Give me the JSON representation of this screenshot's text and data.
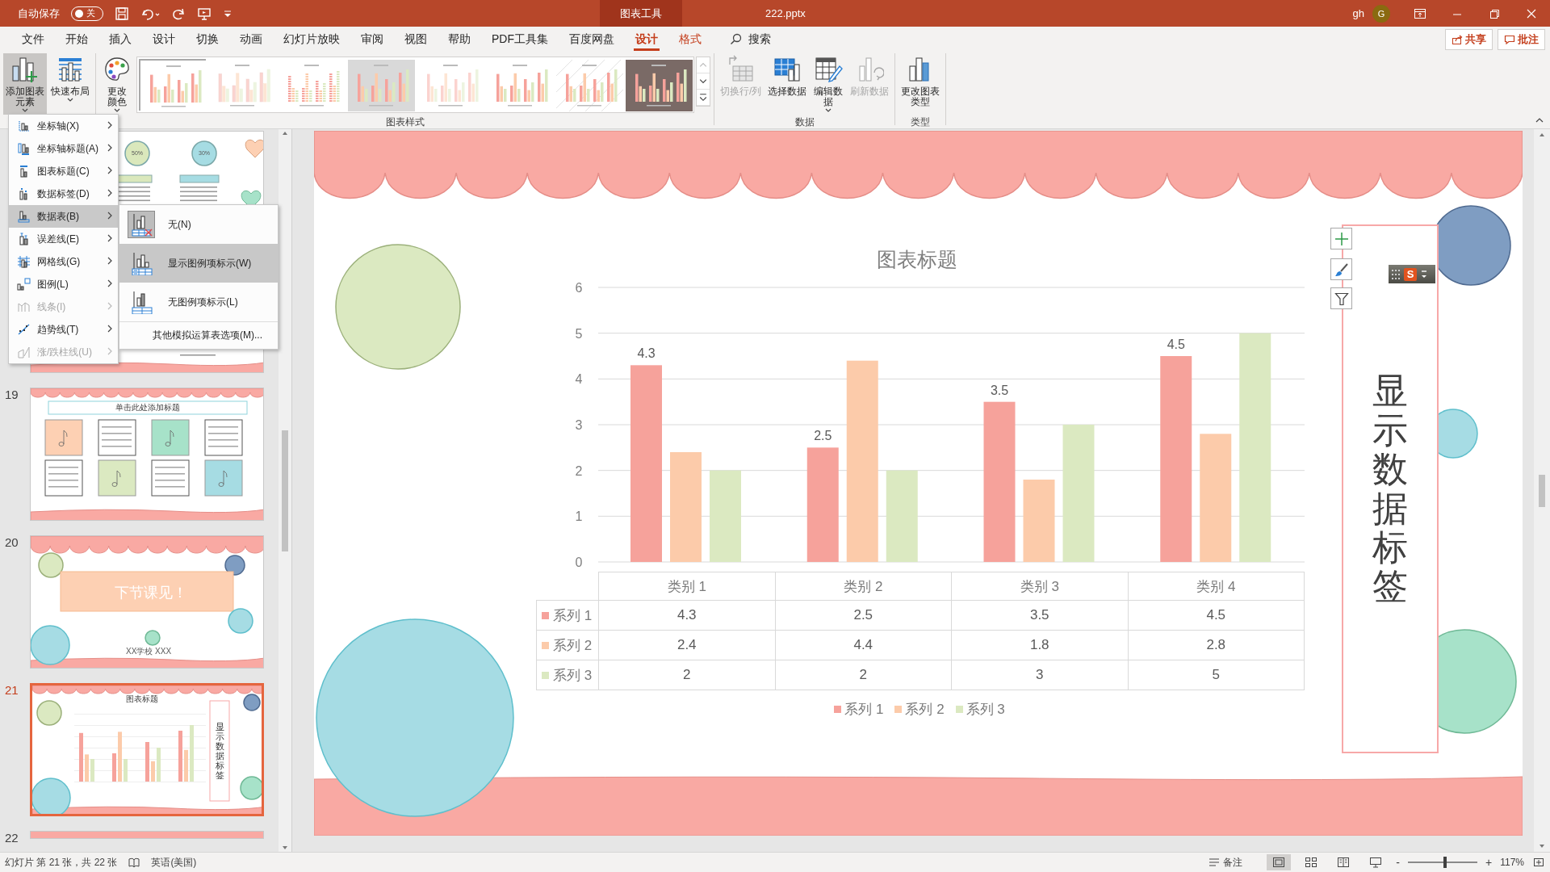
{
  "title_bar": {
    "autosave_label": "自动保存",
    "autosave_toggle": {
      "label": "关",
      "on": false
    },
    "context_tab_group": "图表工具",
    "file_name": "222.pptx",
    "user_name": "gh",
    "avatar_initial": "G"
  },
  "ribbon_tabs": [
    {
      "label": "文件",
      "kind": "normal",
      "selected": false
    },
    {
      "label": "开始",
      "kind": "normal",
      "selected": false
    },
    {
      "label": "插入",
      "kind": "normal",
      "selected": false
    },
    {
      "label": "设计",
      "kind": "normal",
      "selected": false
    },
    {
      "label": "切换",
      "kind": "normal",
      "selected": false
    },
    {
      "label": "动画",
      "kind": "normal",
      "selected": false
    },
    {
      "label": "幻灯片放映",
      "kind": "normal",
      "selected": false
    },
    {
      "label": "审阅",
      "kind": "normal",
      "selected": false
    },
    {
      "label": "视图",
      "kind": "normal",
      "selected": false
    },
    {
      "label": "帮助",
      "kind": "normal",
      "selected": false
    },
    {
      "label": "PDF工具集",
      "kind": "normal",
      "selected": false
    },
    {
      "label": "百度网盘",
      "kind": "normal",
      "selected": false
    },
    {
      "label": "设计",
      "kind": "context",
      "selected": true
    },
    {
      "label": "格式",
      "kind": "context",
      "selected": false
    }
  ],
  "search": {
    "label": "搜索"
  },
  "header_buttons": [
    {
      "label": "共享",
      "kind": "share"
    },
    {
      "label": "批注",
      "kind": "comment"
    }
  ],
  "ribbon": {
    "groups": [
      {
        "buttons": [
          {
            "label": "添加图表元素",
            "kind": "add-element",
            "dropdown": true,
            "expanded": true,
            "disabled": false
          },
          {
            "label": "快速布局",
            "kind": "quick-layout",
            "dropdown": true,
            "expanded": false,
            "disabled": false
          }
        ]
      },
      {
        "label": "图表样式",
        "buttons": [
          {
            "label": "更改颜色",
            "kind": "change-colors",
            "dropdown": true,
            "expanded": false,
            "disabled": false
          }
        ],
        "gallery": [
          {
            "kind": "plain",
            "selected": true
          },
          {
            "kind": "outline",
            "selected": false
          },
          {
            "kind": "dashed",
            "selected": false
          },
          {
            "kind": "grey",
            "selected": false
          },
          {
            "kind": "faded",
            "selected": false
          },
          {
            "kind": "plain",
            "selected": false
          },
          {
            "kind": "hatched",
            "selected": false
          },
          {
            "kind": "dark",
            "selected": false
          }
        ]
      },
      {
        "label": "数据",
        "buttons": [
          {
            "label": "切换行/列",
            "kind": "switch-row-column",
            "dropdown": false,
            "expanded": false,
            "disabled": true
          },
          {
            "label": "选择数据",
            "kind": "select-data",
            "dropdown": false,
            "expanded": false,
            "disabled": false
          },
          {
            "label": "编辑数据",
            "kind": "edit-data",
            "dropdown": true,
            "expanded": false,
            "disabled": false
          },
          {
            "label": "刷新数据",
            "kind": "refresh-data",
            "dropdown": false,
            "expanded": false,
            "disabled": true
          }
        ]
      },
      {
        "label": "类型",
        "buttons": [
          {
            "label": "更改图表类型",
            "kind": "change-chart-type",
            "dropdown": false,
            "expanded": false,
            "disabled": false
          }
        ]
      }
    ]
  },
  "chart_menu": {
    "items": [
      {
        "label": "坐标轴(X)",
        "kind": "axes",
        "disabled": false,
        "selected": false
      },
      {
        "label": "坐标轴标题(A)",
        "kind": "axis-titles",
        "disabled": false,
        "selected": false
      },
      {
        "label": "图表标题(C)",
        "kind": "chart-title",
        "disabled": false,
        "selected": false
      },
      {
        "label": "数据标签(D)",
        "kind": "data-labels",
        "disabled": false,
        "selected": false
      },
      {
        "label": "数据表(B)",
        "kind": "data-table",
        "disabled": false,
        "selected": true
      },
      {
        "label": "误差线(E)",
        "kind": "error-bars",
        "disabled": false,
        "selected": false
      },
      {
        "label": "网格线(G)",
        "kind": "gridlines",
        "disabled": false,
        "selected": false
      },
      {
        "label": "图例(L)",
        "kind": "legend",
        "disabled": false,
        "selected": false
      },
      {
        "label": "线条(I)",
        "kind": "lines",
        "disabled": true,
        "selected": false
      },
      {
        "label": "趋势线(T)",
        "kind": "trendline",
        "disabled": false,
        "selected": false
      },
      {
        "label": "涨/跌柱线(U)",
        "kind": "up-down-bars",
        "disabled": true,
        "selected": false
      }
    ],
    "submenu": [
      {
        "label": "无(N)",
        "kind": "table-none",
        "checked": true,
        "selected": false
      },
      {
        "label": "显示图例项标示(W)",
        "kind": "table-legend",
        "checked": false,
        "selected": true
      },
      {
        "label": "无图例项标示(L)",
        "kind": "table-plain",
        "checked": false,
        "selected": false
      },
      {
        "label": "其他模拟运算表选项(M)...",
        "kind": "more",
        "checked": false,
        "selected": false
      }
    ]
  },
  "slides": [
    {
      "kind": "infographic",
      "selected": false,
      "circles": [
        {
          "label": "50%",
          "color": "#dae8bc"
        },
        {
          "label": "30%",
          "color": "#a6dce3"
        }
      ]
    },
    {
      "number": "19",
      "kind": "grid",
      "selected": false,
      "title": "单击此处添加标题"
    },
    {
      "number": "20",
      "kind": "ending",
      "selected": false,
      "title": "下节课见！",
      "subtitle": "XX学校  XXX"
    },
    {
      "number": "21",
      "kind": "chart",
      "selected": true,
      "title": "图表标题",
      "side_label": "显示数据标签"
    },
    {
      "number": "22",
      "kind": "cut",
      "selected": false
    }
  ],
  "slide": {
    "chart": {
      "chart_data": {
        "type": "bar",
        "title": "图表标题",
        "categories": [
          "类别 1",
          "类别 2",
          "类别 3",
          "类别 4"
        ],
        "series": [
          {
            "name": "系列 1",
            "color": "#f6a29b",
            "values": [
              4.3,
              2.5,
              3.5,
              4.5
            ],
            "data_labels": true
          },
          {
            "name": "系列 2",
            "color": "#fccbaa",
            "values": [
              2.4,
              4.4,
              1.8,
              2.8
            ],
            "data_labels": false
          },
          {
            "name": "系列 3",
            "color": "#dbe9c1",
            "values": [
              2,
              2,
              3,
              5
            ],
            "data_labels": false
          }
        ],
        "grid": true,
        "legend": true,
        "ylim": [
          0,
          6
        ],
        "yticks": [
          {
            "value": 0,
            "label": "0"
          },
          {
            "value": 1,
            "label": "1"
          },
          {
            "value": 2,
            "label": "2"
          },
          {
            "value": 3,
            "label": "3"
          },
          {
            "value": 4,
            "label": "4"
          },
          {
            "value": 5,
            "label": "5"
          },
          {
            "value": 6,
            "label": "6"
          }
        ],
        "value_labels": [
          "4.3",
          "2.5",
          "3.5",
          "4.5"
        ]
      },
      "data_table": {
        "rows": [
          {
            "label": "系列 1",
            "cells": [
              "4.3",
              "2.5",
              "3.5",
              "4.5"
            ]
          },
          {
            "label": "系列 2",
            "cells": [
              "2.4",
              "4.4",
              "1.8",
              "2.8"
            ]
          },
          {
            "label": "系列 3",
            "cells": [
              "2",
              "2",
              "3",
              "5"
            ]
          }
        ]
      }
    },
    "side_label": "显示数据标签",
    "ime_toolbar": {
      "logo": "S"
    }
  },
  "status_bar": {
    "slide_info": "幻灯片 第 21 张，共 22 张",
    "language": "英语(美国)",
    "notes": "备注",
    "views": [
      {
        "kind": "normal",
        "selected": true
      },
      {
        "kind": "sorter",
        "selected": false
      },
      {
        "kind": "reading",
        "selected": false
      },
      {
        "kind": "slideshow",
        "selected": false
      }
    ],
    "zoom": {
      "minus": "-",
      "plus": "+",
      "level": 0.53,
      "percent": "117%"
    }
  }
}
